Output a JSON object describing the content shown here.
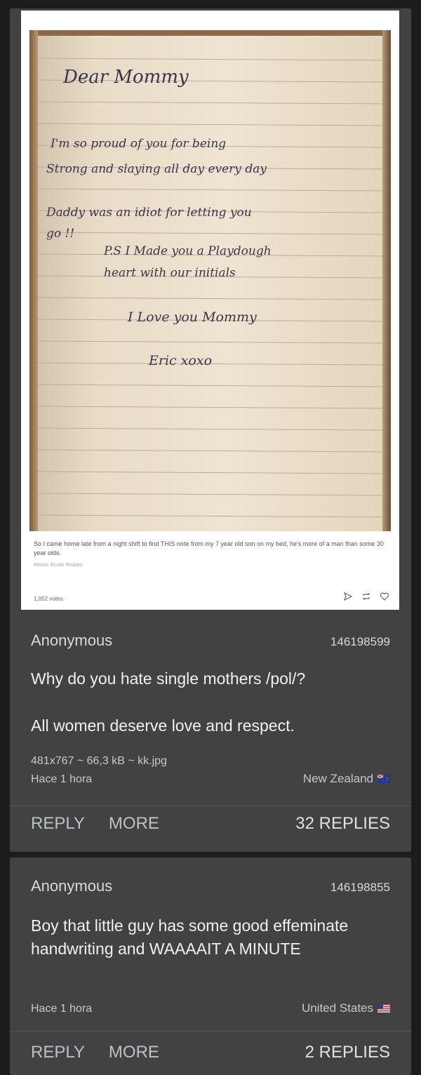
{
  "post": {
    "note": {
      "greeting": "Dear Mommy",
      "line1": "I'm so proud of you for being",
      "line2": "Strong and slaying all day every day",
      "line3": "Daddy was an idiot for letting you",
      "line4": "go !!",
      "line5": "P.S I Made you a Playdough",
      "line6": "heart with our initials",
      "line7": "I Love you Mommy",
      "signature": "Eric xoxo"
    },
    "caption": "So I came home late from a night shift to find THIS note from my 7 year old son on my bed, he's more of a man than some 30 year olds.",
    "tags": "#mom   #cute   #notes",
    "notes_count": "1,052 notes",
    "name": "Anonymous",
    "post_number": "146198599",
    "body_line1": "Why do you hate single mothers /pol/?",
    "body_line2": "All women deserve love and respect.",
    "file_info": "481x767 ~ 66,3 kB ~ kk.jpg",
    "time": "Hace 1 hora",
    "country": "New Zealand",
    "reply_label": "REPLY",
    "more_label": "MORE",
    "replies_count": "32 REPLIES"
  },
  "reply": {
    "name": "Anonymous",
    "post_number": "146198855",
    "body": "Boy that little guy has some good effeminate handwriting and WAAAAIT A MINUTE",
    "time": "Hace 1 hora",
    "country": "United States",
    "reply_label": "REPLY",
    "more_label": "MORE",
    "replies_count": "2 REPLIES"
  },
  "icons": [
    "share-icon",
    "reblog-icon",
    "heart-icon",
    "nz-flag-icon",
    "us-flag-icon"
  ]
}
